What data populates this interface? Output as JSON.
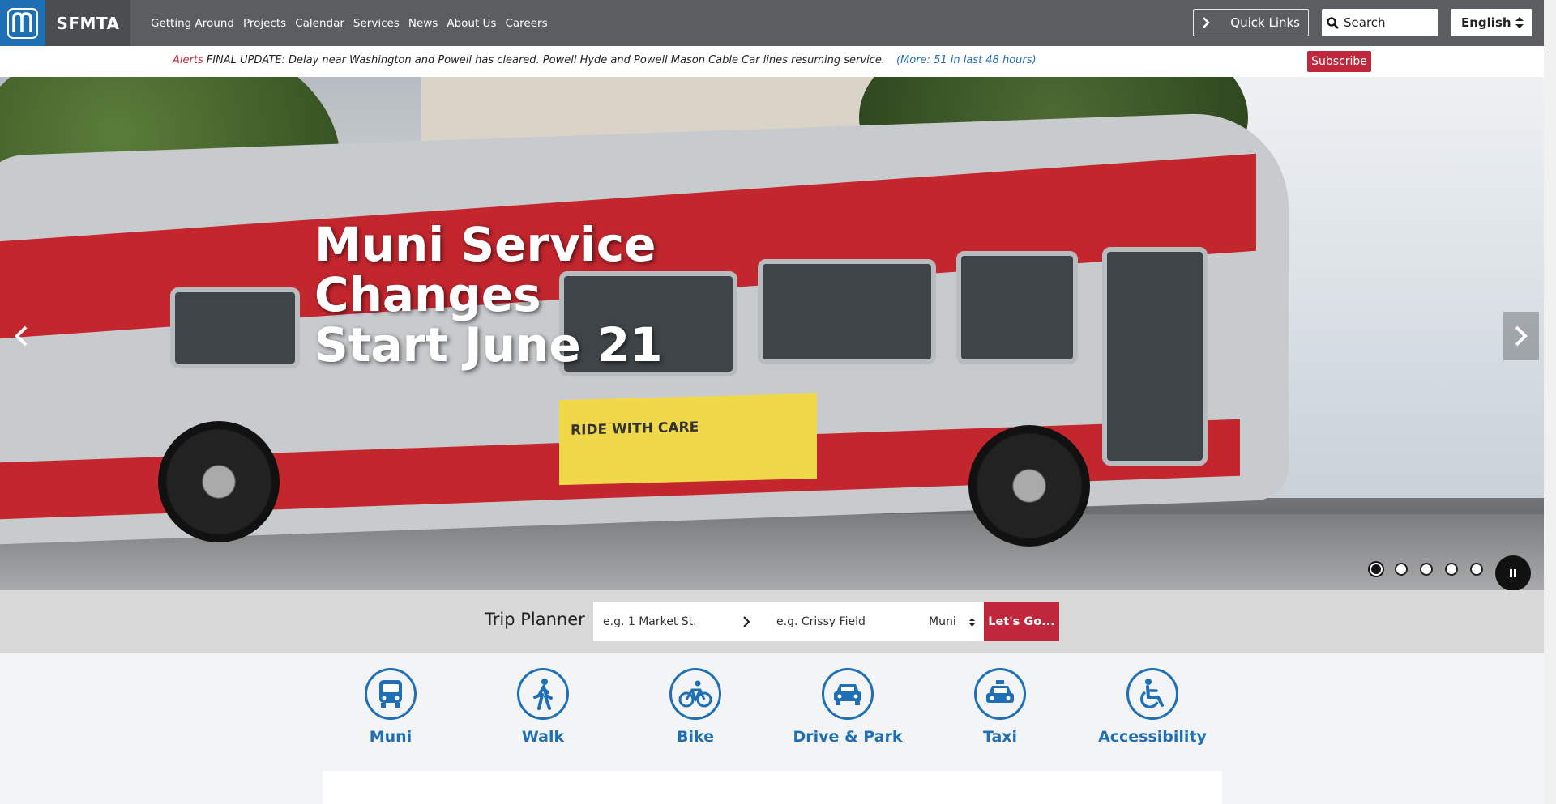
{
  "header": {
    "brand": "SFMTA",
    "nav": [
      "Getting Around",
      "Projects",
      "Calendar",
      "Services",
      "News",
      "About Us",
      "Careers"
    ],
    "quick_links": "Quick Links",
    "search_placeholder": "Search",
    "language": "English"
  },
  "alert": {
    "label": "Alerts",
    "message": "FINAL UPDATE: Delay near Washington and Powell has cleared. Powell Hyde and Powell Mason Cable Car lines resuming service.",
    "more": "(More: 51 in last 48 hours)",
    "subscribe": "Subscribe"
  },
  "hero": {
    "title_line1": "Muni Service",
    "title_line2": "Changes",
    "title_line3": "Start June 21",
    "ad_text": "RIDE WITH CARE",
    "slides": 5,
    "active_slide": 1
  },
  "trip_planner": {
    "label": "Trip Planner",
    "from_placeholder": "e.g. 1 Market St.",
    "to_placeholder": "e.g. Crissy Field",
    "mode": "Muni",
    "go": "Let's Go..."
  },
  "modes": [
    {
      "label": "Muni",
      "icon": "bus-icon"
    },
    {
      "label": "Walk",
      "icon": "walk-icon"
    },
    {
      "label": "Bike",
      "icon": "bike-icon"
    },
    {
      "label": "Drive & Park",
      "icon": "car-icon"
    },
    {
      "label": "Taxi",
      "icon": "taxi-icon"
    },
    {
      "label": "Accessibility",
      "icon": "wheelchair-icon"
    }
  ],
  "colors": {
    "header_bg": "#5b5d61",
    "brand_blue": "#1f6fb5",
    "accent_red": "#c0273c"
  }
}
